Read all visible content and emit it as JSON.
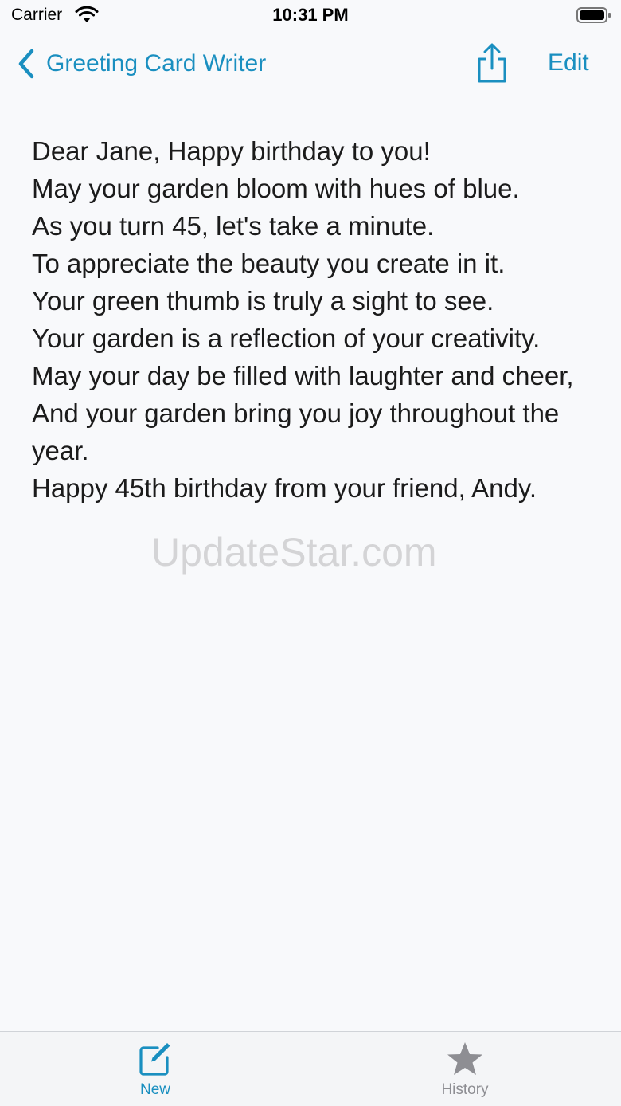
{
  "status_bar": {
    "carrier": "Carrier",
    "time": "10:31 PM"
  },
  "nav": {
    "back_label": "Greeting Card Writer",
    "edit_label": "Edit",
    "accent_color": "#1a8fc0"
  },
  "card": {
    "lines": [
      "Dear Jane, Happy birthday to you!",
      "May your garden bloom with hues of blue.",
      "As you turn 45, let's take a minute.",
      "To appreciate the beauty you create in it.",
      "Your green thumb is truly a sight to see.",
      "Your garden is a reflection of your creativity.",
      "May your day be filled with laughter and cheer,",
      "And your garden bring you joy throughout the year.",
      "Happy 45th birthday from your friend, Andy."
    ]
  },
  "watermark": "UpdateStar.com",
  "tabs": {
    "new_label": "New",
    "history_label": "History",
    "new_icon": "compose-icon",
    "history_icon": "star-icon"
  }
}
